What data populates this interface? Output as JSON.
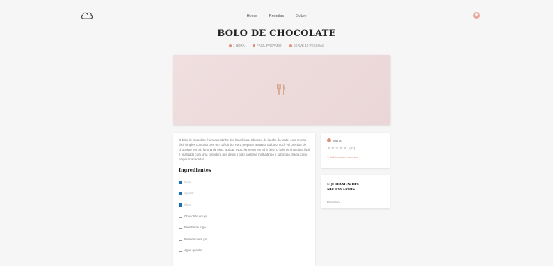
{
  "nav": {
    "links": [
      "Home",
      "Receitas",
      "Sobre"
    ]
  },
  "recipe": {
    "title": "BOLO DE CHOCOLATE",
    "meta": {
      "time": "1 HORA",
      "difficulty": "FÁCIL PREPARO",
      "servings": "SERVE 10 PESSOAS"
    },
    "description": "O bolo de chocolate é um queridinho dos brasileiros. Clássico do lanche da tarde, esta receita fácil simples combina com um cafezinho. Para preparar a massa do bolo, você vai precisar de chocolate em pó, farinha de trigo, açúcar, ovos, fermento em pó e óleo. O bolo de chocolate fácil é finalizado com uma cobertura que deixa o bolo bastante molhadinho e saboroso. Saiba como preparar a receita!",
    "ingredients_title": "Ingredientes",
    "ingredients": [
      {
        "label": "Ovos",
        "checked": true
      },
      {
        "label": "Açúcar",
        "checked": true
      },
      {
        "label": "Óleo",
        "checked": true
      },
      {
        "label": "Chocolate em pó",
        "checked": false
      },
      {
        "label": "Farinha de trigo",
        "checked": false
      },
      {
        "label": "Fermento em pó",
        "checked": false
      },
      {
        "label": "Água quente",
        "checked": false
      }
    ]
  },
  "author_card": {
    "name": "Marta",
    "stars": "★★★★★",
    "rating_count": "(12)",
    "favorite_label": "♡ Adicionar aos favoritos"
  },
  "equipment_card": {
    "title_line1": "EQUIPAMENTOS",
    "title_line2": "NECESSÁRIOS",
    "items": [
      "Batedeira"
    ]
  },
  "colors": {
    "accent": "#e08f7c",
    "checkbox": "#1f6fb0",
    "hero": "#ecdbdc"
  }
}
